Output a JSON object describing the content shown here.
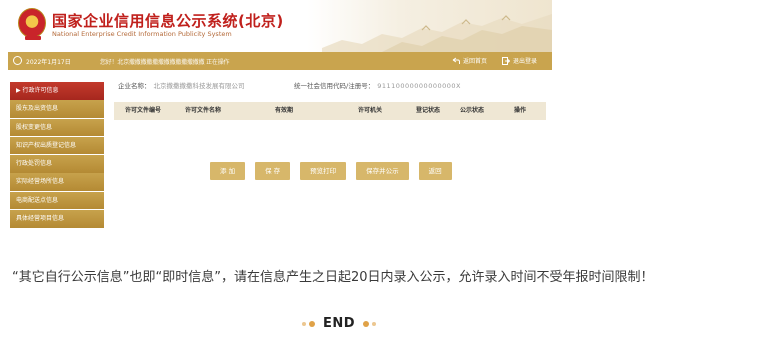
{
  "site": {
    "title": "国家企业信用信息公示系统(北京)",
    "subtitle": "National Enterprise Credit Information Publicity System"
  },
  "topbar": {
    "date": "2022年1月17日",
    "info": "您好！北京撒撒撒撒撒撒撒撒撒撒撒撒撒 正在操作",
    "back_label": "返回首页",
    "logout_label": "退出登录"
  },
  "sidebar": {
    "items": [
      {
        "label": "行政许可信息",
        "active": true
      },
      {
        "label": "股东及出资信息"
      },
      {
        "label": "股权变更信息"
      },
      {
        "label": "知识产权出质登记信息"
      },
      {
        "label": "行政处罚信息"
      },
      {
        "label": "实际经营场所信息"
      },
      {
        "label": "电商配送点信息"
      },
      {
        "label": "具体经营项目信息"
      }
    ]
  },
  "form": {
    "company_label": "企业名称：",
    "company_value": "北京撒撒撒撒科技发展有限公司",
    "credit_label": "统一社会信用代码/注册号：",
    "credit_value": "91110000000000000X"
  },
  "table": {
    "columns": [
      "许可文件编号",
      "许可文件名称",
      "有效期",
      "许可机关",
      "登记状态",
      "公示状态",
      "操作"
    ]
  },
  "buttons": {
    "add": "添 加",
    "save": "保 存",
    "preview": "预览打印",
    "save_publish": "保存并公示",
    "back": "返回"
  },
  "caption": "“其它自行公示信息”也即“即时信息”，请在信息产生之日起20日内录入公示，允许录入时间不受年报时间限制！",
  "end_label": "END",
  "colors": {
    "gold": "#c9a44e",
    "active_red": "#b62d22",
    "title_red": "#c0201c"
  }
}
